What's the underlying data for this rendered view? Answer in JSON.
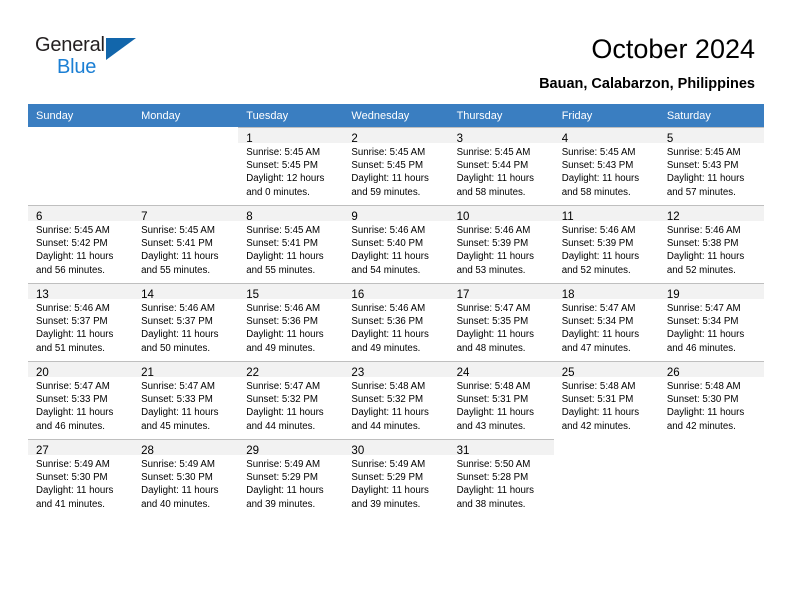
{
  "brand": {
    "name_part1": "General",
    "name_part2": "Blue",
    "triangle_color": "#1266ab",
    "blue_color": "#1b7fd4"
  },
  "header": {
    "title": "October 2024",
    "subtitle": "Bauan, Calabarzon, Philippines",
    "header_bg": "#3a7ec1"
  },
  "calendar": {
    "weekday_headers": [
      "Sunday",
      "Monday",
      "Tuesday",
      "Wednesday",
      "Thursday",
      "Friday",
      "Saturday"
    ],
    "weeks": [
      [
        {
          "day": "",
          "sunrise": "",
          "sunset": "",
          "daylight1": "",
          "daylight2": "",
          "blank": true
        },
        {
          "day": "",
          "sunrise": "",
          "sunset": "",
          "daylight1": "",
          "daylight2": "",
          "blank": true
        },
        {
          "day": "1",
          "sunrise": "Sunrise: 5:45 AM",
          "sunset": "Sunset: 5:45 PM",
          "daylight1": "Daylight: 12 hours",
          "daylight2": "and 0 minutes."
        },
        {
          "day": "2",
          "sunrise": "Sunrise: 5:45 AM",
          "sunset": "Sunset: 5:45 PM",
          "daylight1": "Daylight: 11 hours",
          "daylight2": "and 59 minutes."
        },
        {
          "day": "3",
          "sunrise": "Sunrise: 5:45 AM",
          "sunset": "Sunset: 5:44 PM",
          "daylight1": "Daylight: 11 hours",
          "daylight2": "and 58 minutes."
        },
        {
          "day": "4",
          "sunrise": "Sunrise: 5:45 AM",
          "sunset": "Sunset: 5:43 PM",
          "daylight1": "Daylight: 11 hours",
          "daylight2": "and 58 minutes."
        },
        {
          "day": "5",
          "sunrise": "Sunrise: 5:45 AM",
          "sunset": "Sunset: 5:43 PM",
          "daylight1": "Daylight: 11 hours",
          "daylight2": "and 57 minutes."
        }
      ],
      [
        {
          "day": "6",
          "sunrise": "Sunrise: 5:45 AM",
          "sunset": "Sunset: 5:42 PM",
          "daylight1": "Daylight: 11 hours",
          "daylight2": "and 56 minutes."
        },
        {
          "day": "7",
          "sunrise": "Sunrise: 5:45 AM",
          "sunset": "Sunset: 5:41 PM",
          "daylight1": "Daylight: 11 hours",
          "daylight2": "and 55 minutes."
        },
        {
          "day": "8",
          "sunrise": "Sunrise: 5:45 AM",
          "sunset": "Sunset: 5:41 PM",
          "daylight1": "Daylight: 11 hours",
          "daylight2": "and 55 minutes."
        },
        {
          "day": "9",
          "sunrise": "Sunrise: 5:46 AM",
          "sunset": "Sunset: 5:40 PM",
          "daylight1": "Daylight: 11 hours",
          "daylight2": "and 54 minutes."
        },
        {
          "day": "10",
          "sunrise": "Sunrise: 5:46 AM",
          "sunset": "Sunset: 5:39 PM",
          "daylight1": "Daylight: 11 hours",
          "daylight2": "and 53 minutes."
        },
        {
          "day": "11",
          "sunrise": "Sunrise: 5:46 AM",
          "sunset": "Sunset: 5:39 PM",
          "daylight1": "Daylight: 11 hours",
          "daylight2": "and 52 minutes."
        },
        {
          "day": "12",
          "sunrise": "Sunrise: 5:46 AM",
          "sunset": "Sunset: 5:38 PM",
          "daylight1": "Daylight: 11 hours",
          "daylight2": "and 52 minutes."
        }
      ],
      [
        {
          "day": "13",
          "sunrise": "Sunrise: 5:46 AM",
          "sunset": "Sunset: 5:37 PM",
          "daylight1": "Daylight: 11 hours",
          "daylight2": "and 51 minutes."
        },
        {
          "day": "14",
          "sunrise": "Sunrise: 5:46 AM",
          "sunset": "Sunset: 5:37 PM",
          "daylight1": "Daylight: 11 hours",
          "daylight2": "and 50 minutes."
        },
        {
          "day": "15",
          "sunrise": "Sunrise: 5:46 AM",
          "sunset": "Sunset: 5:36 PM",
          "daylight1": "Daylight: 11 hours",
          "daylight2": "and 49 minutes."
        },
        {
          "day": "16",
          "sunrise": "Sunrise: 5:46 AM",
          "sunset": "Sunset: 5:36 PM",
          "daylight1": "Daylight: 11 hours",
          "daylight2": "and 49 minutes."
        },
        {
          "day": "17",
          "sunrise": "Sunrise: 5:47 AM",
          "sunset": "Sunset: 5:35 PM",
          "daylight1": "Daylight: 11 hours",
          "daylight2": "and 48 minutes."
        },
        {
          "day": "18",
          "sunrise": "Sunrise: 5:47 AM",
          "sunset": "Sunset: 5:34 PM",
          "daylight1": "Daylight: 11 hours",
          "daylight2": "and 47 minutes."
        },
        {
          "day": "19",
          "sunrise": "Sunrise: 5:47 AM",
          "sunset": "Sunset: 5:34 PM",
          "daylight1": "Daylight: 11 hours",
          "daylight2": "and 46 minutes."
        }
      ],
      [
        {
          "day": "20",
          "sunrise": "Sunrise: 5:47 AM",
          "sunset": "Sunset: 5:33 PM",
          "daylight1": "Daylight: 11 hours",
          "daylight2": "and 46 minutes."
        },
        {
          "day": "21",
          "sunrise": "Sunrise: 5:47 AM",
          "sunset": "Sunset: 5:33 PM",
          "daylight1": "Daylight: 11 hours",
          "daylight2": "and 45 minutes."
        },
        {
          "day": "22",
          "sunrise": "Sunrise: 5:47 AM",
          "sunset": "Sunset: 5:32 PM",
          "daylight1": "Daylight: 11 hours",
          "daylight2": "and 44 minutes."
        },
        {
          "day": "23",
          "sunrise": "Sunrise: 5:48 AM",
          "sunset": "Sunset: 5:32 PM",
          "daylight1": "Daylight: 11 hours",
          "daylight2": "and 44 minutes."
        },
        {
          "day": "24",
          "sunrise": "Sunrise: 5:48 AM",
          "sunset": "Sunset: 5:31 PM",
          "daylight1": "Daylight: 11 hours",
          "daylight2": "and 43 minutes."
        },
        {
          "day": "25",
          "sunrise": "Sunrise: 5:48 AM",
          "sunset": "Sunset: 5:31 PM",
          "daylight1": "Daylight: 11 hours",
          "daylight2": "and 42 minutes."
        },
        {
          "day": "26",
          "sunrise": "Sunrise: 5:48 AM",
          "sunset": "Sunset: 5:30 PM",
          "daylight1": "Daylight: 11 hours",
          "daylight2": "and 42 minutes."
        }
      ],
      [
        {
          "day": "27",
          "sunrise": "Sunrise: 5:49 AM",
          "sunset": "Sunset: 5:30 PM",
          "daylight1": "Daylight: 11 hours",
          "daylight2": "and 41 minutes."
        },
        {
          "day": "28",
          "sunrise": "Sunrise: 5:49 AM",
          "sunset": "Sunset: 5:30 PM",
          "daylight1": "Daylight: 11 hours",
          "daylight2": "and 40 minutes."
        },
        {
          "day": "29",
          "sunrise": "Sunrise: 5:49 AM",
          "sunset": "Sunset: 5:29 PM",
          "daylight1": "Daylight: 11 hours",
          "daylight2": "and 39 minutes."
        },
        {
          "day": "30",
          "sunrise": "Sunrise: 5:49 AM",
          "sunset": "Sunset: 5:29 PM",
          "daylight1": "Daylight: 11 hours",
          "daylight2": "and 39 minutes."
        },
        {
          "day": "31",
          "sunrise": "Sunrise: 5:50 AM",
          "sunset": "Sunset: 5:28 PM",
          "daylight1": "Daylight: 11 hours",
          "daylight2": "and 38 minutes."
        },
        {
          "day": "",
          "sunrise": "",
          "sunset": "",
          "daylight1": "",
          "daylight2": "",
          "blank": true
        },
        {
          "day": "",
          "sunrise": "",
          "sunset": "",
          "daylight1": "",
          "daylight2": "",
          "blank": true
        }
      ]
    ]
  }
}
